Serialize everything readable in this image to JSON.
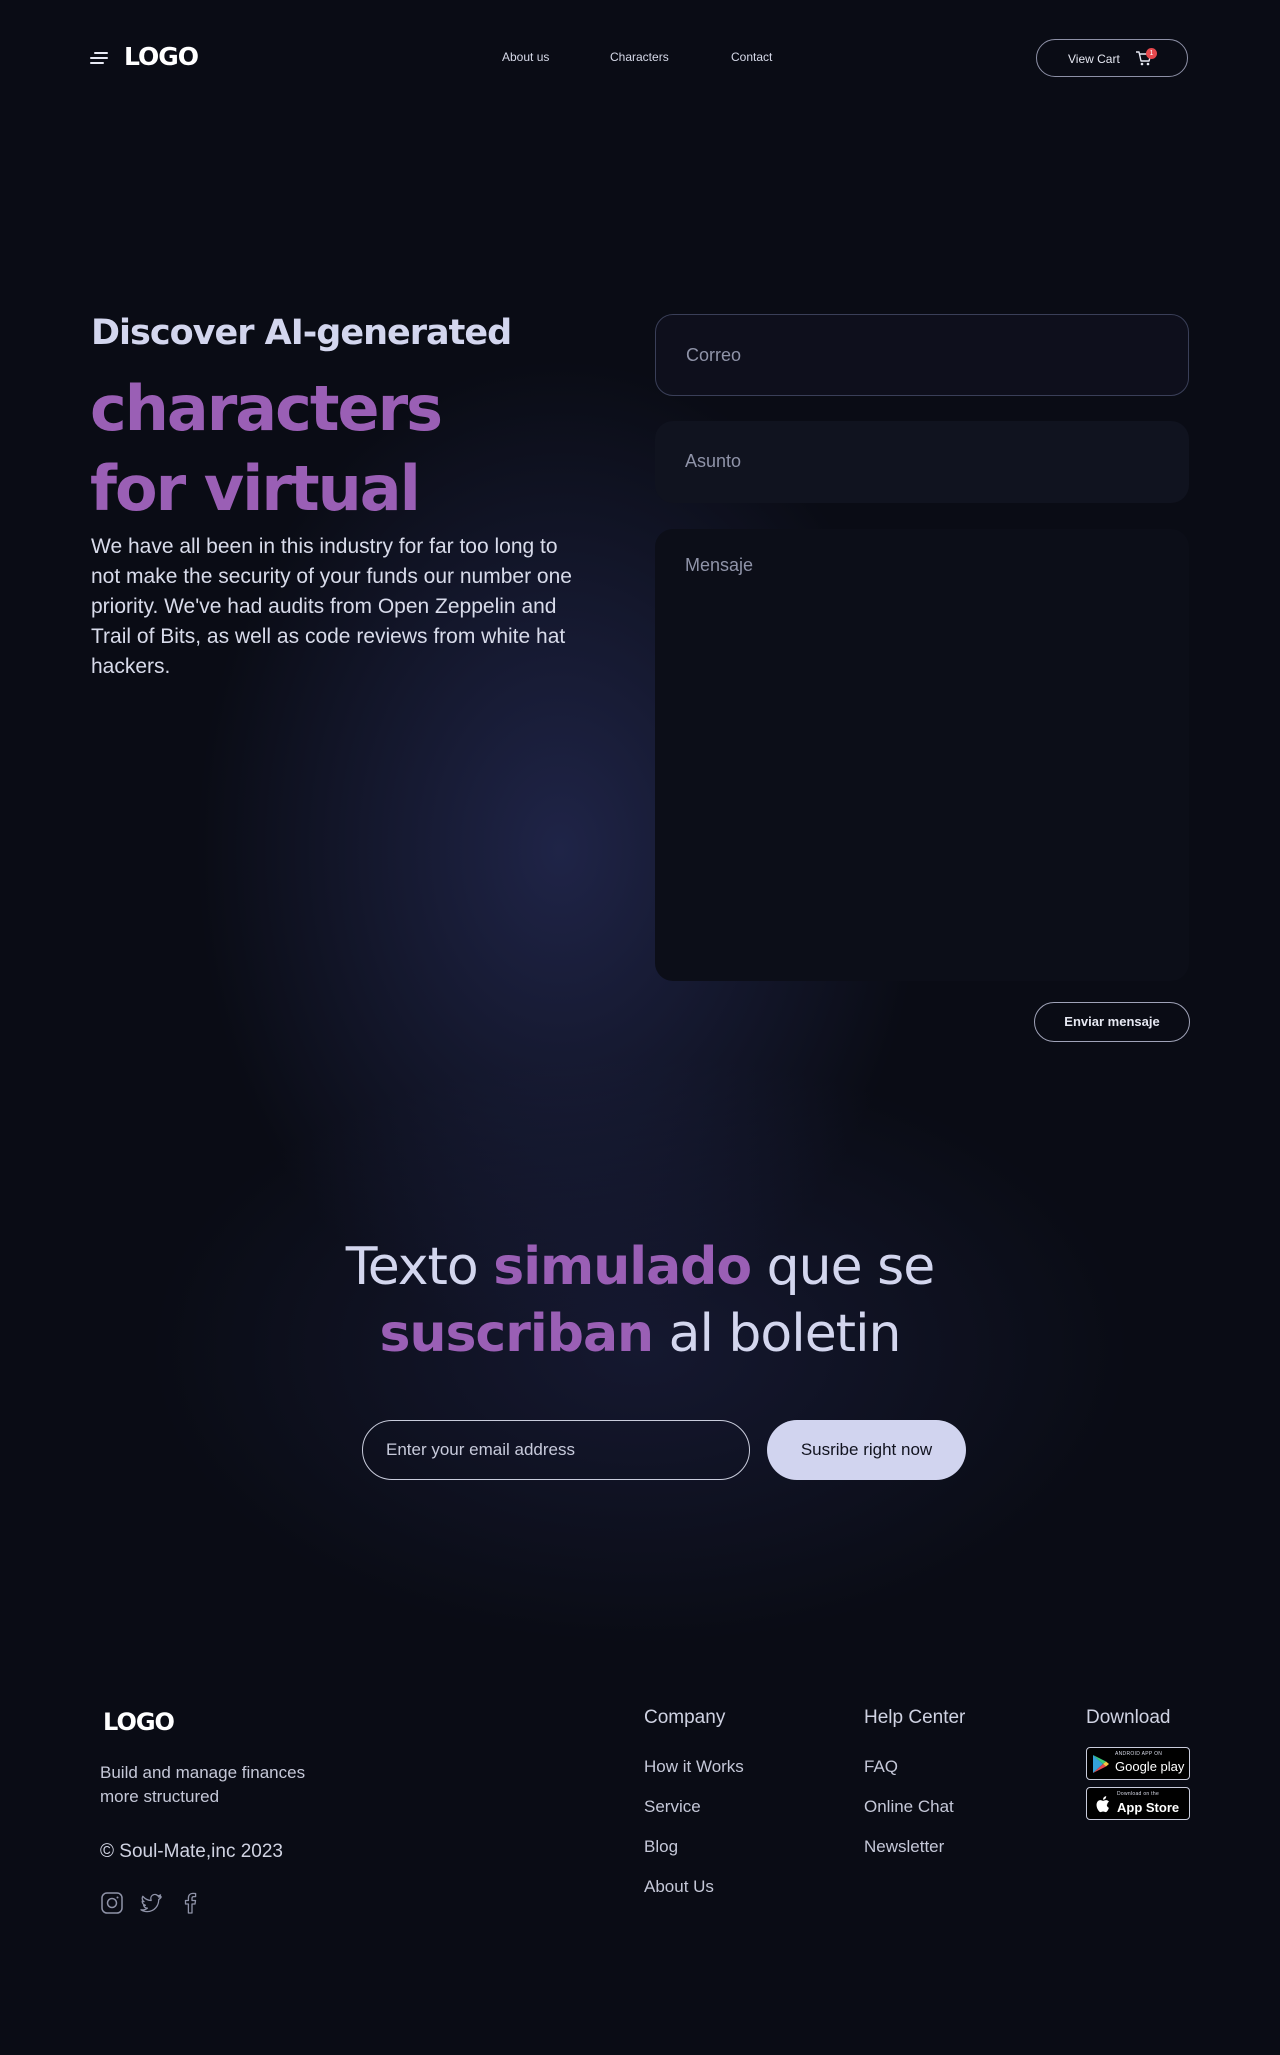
{
  "header": {
    "logo": "LOGO",
    "nav": [
      "About us",
      "Characters",
      "Contact"
    ],
    "cart_label": "View Cart",
    "cart_count": "1"
  },
  "hero": {
    "kicker": "Discover AI-generated",
    "title_line1": "characters",
    "title_line2": "for virtual",
    "body": "We have all been in this industry for far too long to not make the security of your funds our number one priority. We've had audits from Open Zeppelin and Trail of Bits, as well as code reviews from white hat hackers."
  },
  "contact_form": {
    "email_placeholder": "Correo",
    "subject_placeholder": "Asunto",
    "message_placeholder": "Mensaje",
    "submit_label": "Enviar mensaje"
  },
  "newsletter": {
    "line1_a": "Texto",
    "line1_b": "simulado",
    "line1_c": "que se",
    "line2_a": "suscriban",
    "line2_b": "al boletin",
    "email_placeholder": "Enter your email address",
    "button_label": "Susribe right now"
  },
  "footer": {
    "logo": "LOGO",
    "tagline": "Build and manage finances more structured",
    "copyright": "© Soul-Mate,inc 2023",
    "social_icons": [
      "instagram-icon",
      "twitter-icon",
      "facebook-icon"
    ],
    "columns": [
      {
        "title": "Company",
        "links": [
          "How it Works",
          "Service",
          "Blog",
          "About Us"
        ]
      },
      {
        "title": "Help Center",
        "links": [
          "FAQ",
          "Online Chat",
          "Newsletter"
        ]
      },
      {
        "title": "Download"
      }
    ],
    "google_play": {
      "small": "ANDROID APP ON",
      "big": "Google play"
    },
    "app_store": {
      "small": "Download on the",
      "big": "App Store"
    }
  },
  "colors": {
    "background": "#0a0c15",
    "accent_purple": "#9a5fb5",
    "heading_lavender": "#d3d6ee",
    "subscribe_button": "#d1d4ef",
    "cart_badge": "#e5484d"
  }
}
